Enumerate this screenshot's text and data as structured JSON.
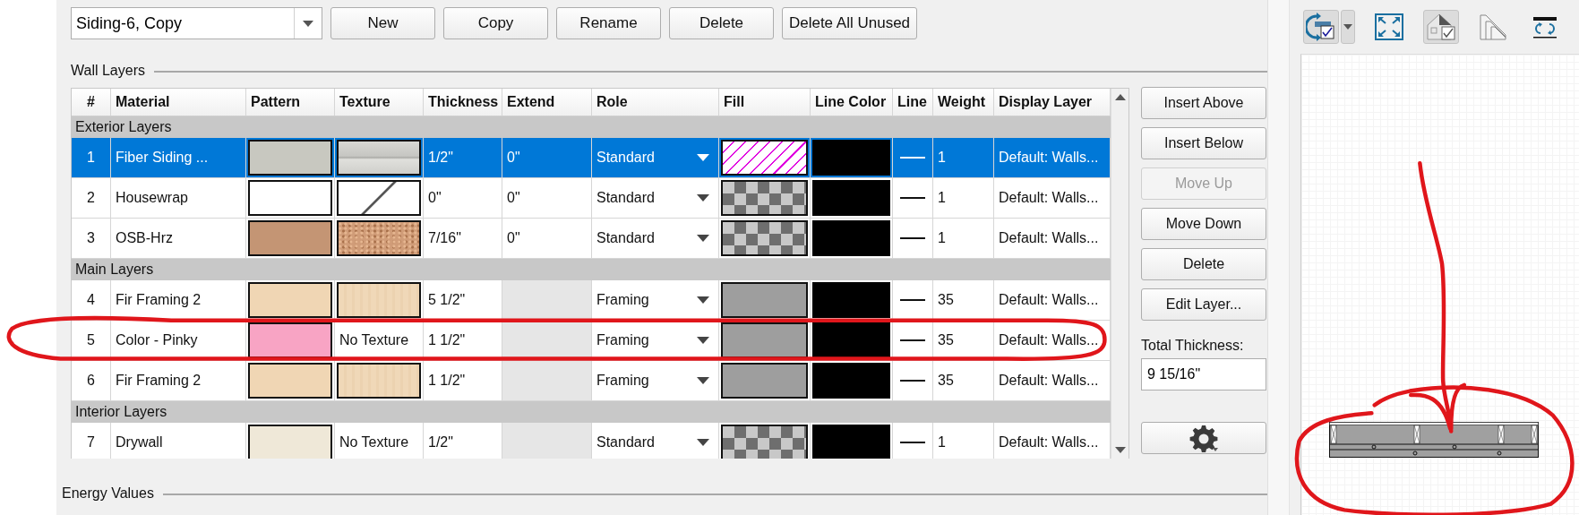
{
  "style_bar": {
    "style_name": "Siding-6, Copy",
    "buttons": [
      {
        "label": "New",
        "disabled": false
      },
      {
        "label": "Copy",
        "disabled": false
      },
      {
        "label": "Rename",
        "disabled": false
      },
      {
        "label": "Delete",
        "disabled": false
      },
      {
        "label": "Delete All Unused",
        "disabled": false
      }
    ]
  },
  "wall_layers": {
    "title": "Wall Layers",
    "table": {
      "columns": [
        "#",
        "Material",
        "Pattern",
        "Texture",
        "Thickness",
        "Extend",
        "Role",
        "Fill",
        "Line Color",
        "Line",
        "Weight",
        "Display Layer"
      ],
      "groups": [
        {
          "label": "Exterior Layers",
          "rows": [
            {
              "number": "1",
              "material": "Fiber Siding ...",
              "selected": true,
              "pattern": {
                "color": "#c8c8c0"
              },
              "texture": {
                "kind": "siding"
              },
              "thickness": "1/2\"",
              "extend_disabled": false,
              "extend": "0\"",
              "role": "Standard",
              "fill": {
                "kind": "hatch"
              },
              "weight": "1",
              "display_layer": "Default: Walls..."
            },
            {
              "number": "2",
              "material": "Housewrap",
              "selected": false,
              "pattern": {
                "color": "#ffffff"
              },
              "texture": {
                "kind": "stamp"
              },
              "thickness": "0\"",
              "extend_disabled": false,
              "extend": "0\"",
              "role": "Standard",
              "fill": {
                "kind": "checker"
              },
              "weight": "1",
              "display_layer": "Default: Walls..."
            },
            {
              "number": "3",
              "material": "OSB-Hrz",
              "selected": false,
              "pattern": {
                "color": "#c49574"
              },
              "texture": {
                "kind": "osb"
              },
              "thickness": "7/16\"",
              "extend_disabled": false,
              "extend": "0\"",
              "role": "Standard",
              "fill": {
                "kind": "checker"
              },
              "weight": "1",
              "display_layer": "Default: Walls..."
            }
          ]
        },
        {
          "label": "Main Layers",
          "rows": [
            {
              "number": "4",
              "material": "Fir Framing 2",
              "selected": false,
              "pattern": {
                "color": "#f0d6b4"
              },
              "texture": {
                "kind": "wood"
              },
              "thickness": "5 1/2\"",
              "extend_disabled": true,
              "role": "Framing",
              "fill": {
                "kind": "solid"
              },
              "weight": "35",
              "display_layer": "Default: Walls..."
            },
            {
              "number": "5",
              "material": "Color - Pinky",
              "selected": false,
              "pattern": {
                "color": "#f8a4c4"
              },
              "texture": {
                "kind": "none",
                "label": "No Texture"
              },
              "thickness": "1 1/2\"",
              "extend_disabled": true,
              "role": "Framing",
              "fill": {
                "kind": "solid"
              },
              "weight": "35",
              "display_layer": "Default: Walls..."
            },
            {
              "number": "6",
              "material": "Fir Framing 2",
              "selected": false,
              "pattern": {
                "color": "#f0d6b4"
              },
              "texture": {
                "kind": "wood"
              },
              "thickness": "1 1/2\"",
              "extend_disabled": true,
              "role": "Framing",
              "fill": {
                "kind": "solid"
              },
              "weight": "35",
              "display_layer": "Default: Walls..."
            }
          ]
        },
        {
          "label": "Interior Layers",
          "rows": [
            {
              "number": "7",
              "material": "Drywall",
              "selected": false,
              "pattern": {
                "color": "#efe8d8"
              },
              "texture": {
                "kind": "none",
                "label": "No Texture"
              },
              "thickness": "1/2\"",
              "extend_disabled": true,
              "role": "Standard",
              "fill": {
                "kind": "checker"
              },
              "weight": "1",
              "display_layer": "Default: Walls..."
            }
          ]
        }
      ]
    },
    "side_buttons": [
      {
        "label": "Insert Above",
        "disabled": false
      },
      {
        "label": "Insert Below",
        "disabled": false
      },
      {
        "label": "Move Up",
        "disabled": true
      },
      {
        "label": "Move Down",
        "disabled": false
      },
      {
        "label": "Delete",
        "disabled": false
      },
      {
        "label": "Edit Layer...",
        "disabled": false
      }
    ],
    "total_thickness": {
      "label": "Total Thickness:",
      "value": "9 15/16\""
    }
  },
  "energy_values": {
    "title": "Energy Values"
  },
  "preview": {
    "tools": [
      {
        "kind": "rotate",
        "pressed": true,
        "dropdown": true
      },
      {
        "kind": "fit",
        "pressed": false,
        "dropdown": false
      },
      {
        "kind": "house",
        "pressed": true,
        "dropdown": false
      },
      {
        "kind": "layers",
        "pressed": false,
        "dropdown": false
      },
      {
        "kind": "flip",
        "pressed": false,
        "dropdown": false
      }
    ]
  }
}
